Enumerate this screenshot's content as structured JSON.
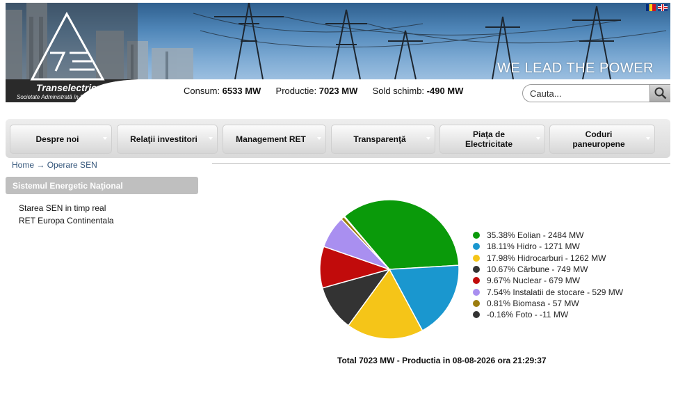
{
  "header": {
    "slogan": "WE LEAD THE POWER",
    "logo_name": "Transelectrica",
    "logo_subtitle": "Societate Administrată în Sistem Dualist",
    "languages": [
      "ro",
      "en"
    ]
  },
  "stats": {
    "consum_label": "Consum:",
    "consum_value": "6533 MW",
    "productie_label": "Productie:",
    "productie_value": "7023 MW",
    "sold_label": "Sold schimb:",
    "sold_value": "-490 MW"
  },
  "search": {
    "placeholder": "Cauta...",
    "icon": "search-icon"
  },
  "nav": {
    "items": [
      {
        "label": "Despre noi"
      },
      {
        "label": "Relaţii investitori"
      },
      {
        "label": "Management RET"
      },
      {
        "label": "Transparenţă"
      },
      {
        "label": "Piaţa de Electricitate"
      },
      {
        "label": "Coduri paneuropene"
      }
    ]
  },
  "breadcrumb": {
    "home": "Home",
    "separator": "→",
    "current": "Operare SEN"
  },
  "sidebar": {
    "title": "Sistemul Energetic Naţional",
    "items": [
      {
        "label": "Starea SEN in timp real"
      },
      {
        "label": "RET Europa Continentala"
      }
    ]
  },
  "chart_data": {
    "type": "pie",
    "caption": "Total 7023 MW - Productia in 08-08-2026 ora 21:29:37",
    "slices": [
      {
        "label": "35.38% Eolian - 2484 MW",
        "percent": 35.38,
        "value": 2484,
        "color": "#0a9a0a"
      },
      {
        "label": "18.11% Hidro - 1271 MW",
        "percent": 18.11,
        "value": 1271,
        "color": "#1a97cf"
      },
      {
        "label": "17.98% Hidrocarburi - 1262 MW",
        "percent": 17.98,
        "value": 1262,
        "color": "#f5c518"
      },
      {
        "label": "10.67% Cărbune - 749 MW",
        "percent": 10.67,
        "value": 749,
        "color": "#333333"
      },
      {
        "label": "9.67% Nuclear - 679 MW",
        "percent": 9.67,
        "value": 679,
        "color": "#c10b0b"
      },
      {
        "label": "7.54% Instalatii de stocare - 529 MW",
        "percent": 7.54,
        "value": 529,
        "color": "#a98ff0"
      },
      {
        "label": "0.81% Biomasa - 57 MW",
        "percent": 0.81,
        "value": 57,
        "color": "#9c7d0e"
      },
      {
        "label": "-0.16% Foto - -11 MW",
        "percent": -0.16,
        "value": -11,
        "color": "#333333"
      }
    ]
  }
}
